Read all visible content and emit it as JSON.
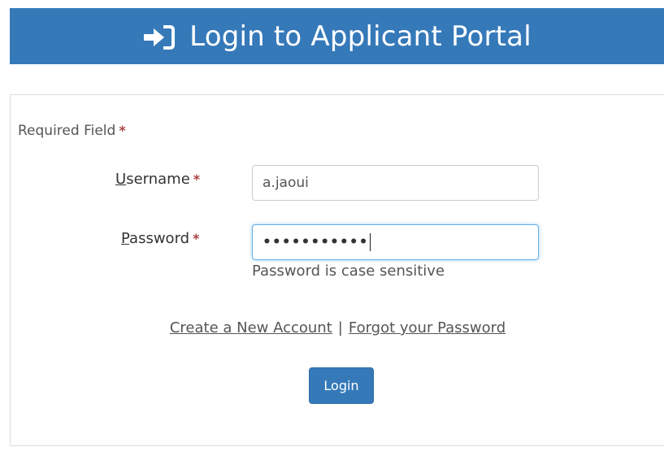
{
  "header": {
    "icon": "sign-in-icon",
    "title": "Login to Applicant Portal"
  },
  "form": {
    "required_note": "Required Field",
    "required_marker": "*",
    "username": {
      "label_first": "U",
      "label_rest": "sername",
      "value": "a.jaoui"
    },
    "password": {
      "label_first": "P",
      "label_rest": "assword",
      "masked_value": "•••••••••••",
      "help": "Password is case sensitive"
    },
    "links": {
      "create_account": "Create a New Account",
      "separator": "|",
      "forgot_password": "Forgot your Password"
    },
    "login_label": "Login"
  },
  "colors": {
    "primary": "#3579b9",
    "required": "#a94442",
    "focus": "#66afe9"
  }
}
